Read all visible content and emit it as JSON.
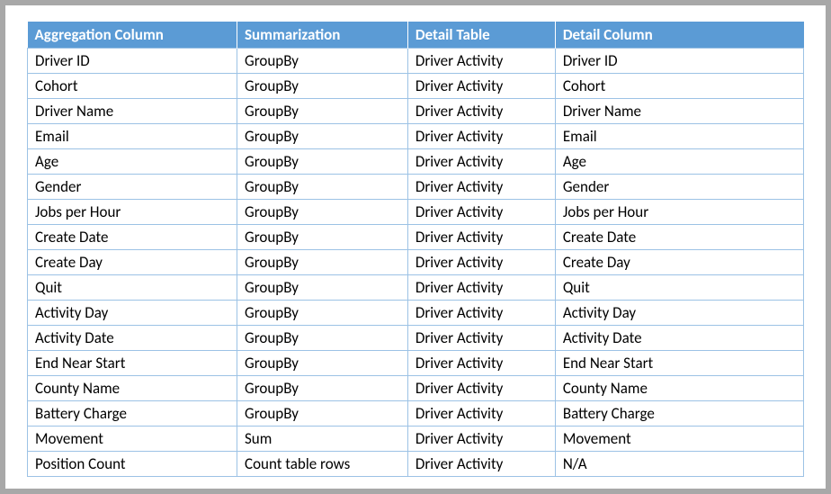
{
  "table": {
    "headers": [
      "Aggregation Column",
      "Summarization",
      "Detail Table",
      "Detail Column"
    ],
    "rows": [
      [
        "Driver ID",
        "GroupBy",
        "Driver Activity",
        "Driver ID"
      ],
      [
        "Cohort",
        "GroupBy",
        "Driver Activity",
        "Cohort"
      ],
      [
        "Driver Name",
        "GroupBy",
        "Driver Activity",
        "Driver Name"
      ],
      [
        "Email",
        "GroupBy",
        "Driver Activity",
        "Email"
      ],
      [
        "Age",
        "GroupBy",
        "Driver Activity",
        "Age"
      ],
      [
        "Gender",
        "GroupBy",
        "Driver Activity",
        "Gender"
      ],
      [
        "Jobs per Hour",
        "GroupBy",
        "Driver Activity",
        "Jobs per Hour"
      ],
      [
        "Create Date",
        "GroupBy",
        "Driver Activity",
        "Create Date"
      ],
      [
        "Create Day",
        "GroupBy",
        "Driver Activity",
        "Create Day"
      ],
      [
        "Quit",
        "GroupBy",
        "Driver Activity",
        "Quit"
      ],
      [
        "Activity Day",
        "GroupBy",
        "Driver Activity",
        "Activity Day"
      ],
      [
        "Activity Date",
        "GroupBy",
        "Driver Activity",
        "Activity Date"
      ],
      [
        "End Near Start",
        "GroupBy",
        "Driver Activity",
        "End Near Start"
      ],
      [
        "County Name",
        "GroupBy",
        "Driver Activity",
        "County Name"
      ],
      [
        "Battery Charge",
        "GroupBy",
        "Driver Activity",
        "Battery Charge"
      ],
      [
        "Movement",
        "Sum",
        "Driver Activity",
        "Movement"
      ],
      [
        "Position Count",
        "Count table rows",
        "Driver Activity",
        "N/A"
      ]
    ]
  }
}
